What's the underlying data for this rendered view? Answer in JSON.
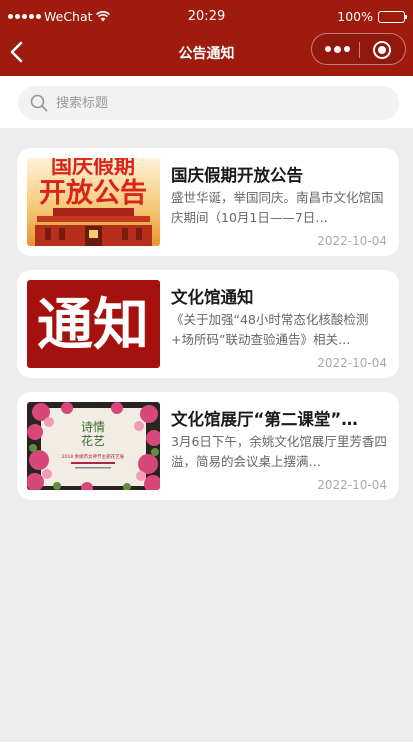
{
  "status_bar": {
    "carrier": "WeChat",
    "time": "20:29",
    "battery": "100%"
  },
  "nav": {
    "title": "公告通知"
  },
  "search": {
    "placeholder": "搜索标题"
  },
  "articles": [
    {
      "title": "国庆假期开放公告",
      "summary": "盛世华诞，举国同庆。南昌市文化馆国庆期间（10月1日——7日…",
      "date": "2022-10-04",
      "thumb_text": [
        "国庆假期",
        "开放公告"
      ]
    },
    {
      "title": "文化馆通知",
      "summary": "《关于加强“48小时常态化核酸检测+场所码”联动查验通告》相关…",
      "date": "2022-10-04",
      "thumb_text": [
        "通知"
      ]
    },
    {
      "title": "文化馆展厅“第二课堂”…",
      "summary": "3月6日下午，余姚文化馆展厅里芳香四溢，简易的会议桌上摆满…",
      "date": "2022-10-04",
      "thumb_text": [
        "诗情",
        "花艺",
        "2018 余姚市女神节主题花艺展"
      ]
    }
  ],
  "colors": {
    "brand": "#9e1b0e",
    "background": "#ededed"
  }
}
